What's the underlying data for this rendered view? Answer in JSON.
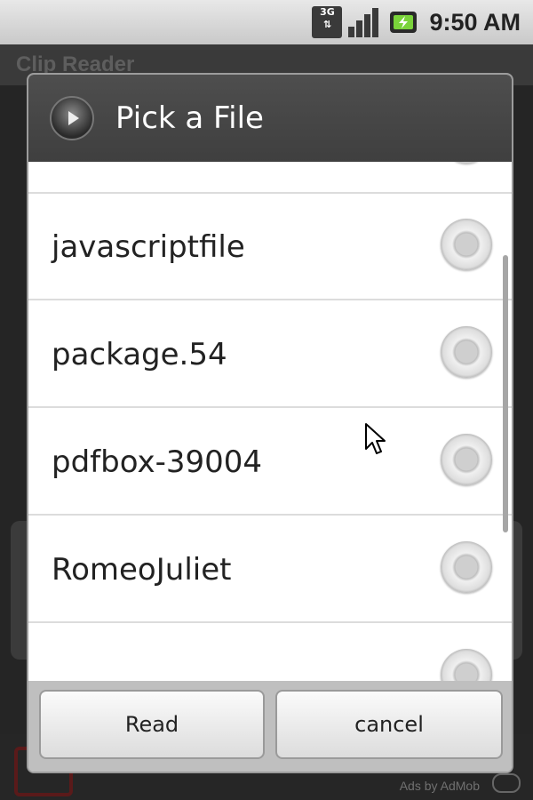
{
  "status_bar": {
    "network_label": "3G",
    "time": "9:50 AM"
  },
  "app": {
    "title": "Clip Reader",
    "ad_text": "Ads by AdMob"
  },
  "dialog": {
    "title": "Pick a File",
    "files": [
      {
        "name": "",
        "selected": false
      },
      {
        "name": "javascriptfile",
        "selected": false
      },
      {
        "name": "package.54",
        "selected": false
      },
      {
        "name": "pdfbox-39004",
        "selected": false
      },
      {
        "name": "RomeoJuliet",
        "selected": false
      },
      {
        "name": "",
        "selected": false
      }
    ],
    "buttons": {
      "read": "Read",
      "cancel": "cancel"
    }
  },
  "colors": {
    "dialog_header": "#474747",
    "footer": "#bfbfbf",
    "status_bar": "#d6d6d6"
  }
}
